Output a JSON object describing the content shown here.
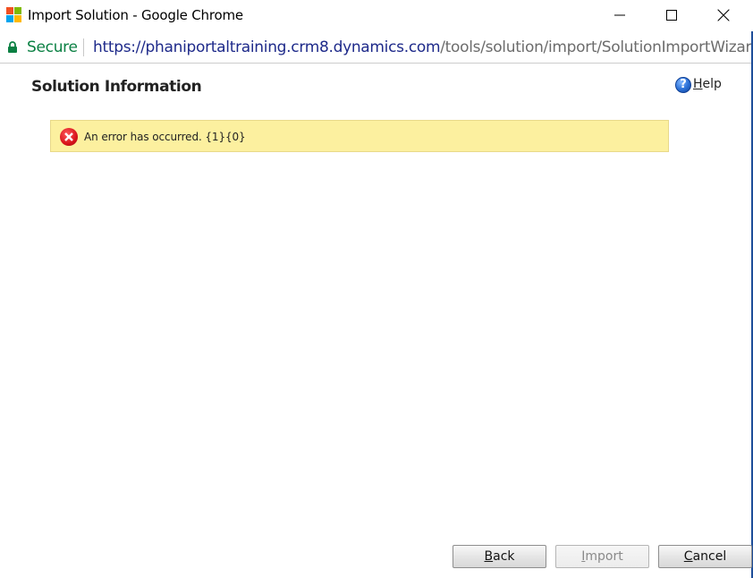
{
  "window": {
    "title": "Import Solution - Google Chrome",
    "controls": {
      "minimize": "minimize",
      "maximize": "maximize",
      "close": "close"
    }
  },
  "address_bar": {
    "security_label": "Secure",
    "url_host": "https://phaniportaltraining.crm8.dynamics.com",
    "url_path": "/tools/solution/import/SolutionImportWizard...."
  },
  "page": {
    "title": "Solution Information",
    "help": {
      "accel": "H",
      "rest": "elp",
      "icon": "question-mark"
    }
  },
  "error": {
    "message": "An error has occurred. {1}{0}",
    "icon": "error-x-icon",
    "background": "#fcf09f"
  },
  "footer": {
    "back": {
      "accel": "B",
      "rest": "ack",
      "enabled": true
    },
    "import": {
      "accel": "I",
      "rest": "mport",
      "enabled": false
    },
    "cancel": {
      "accel": "C",
      "rest": "ancel",
      "enabled": true
    }
  },
  "colors": {
    "secure_green": "#0b8043",
    "url_host": "#1e2a8a",
    "url_path": "#6c6c6c",
    "window_border": "#1f4e99",
    "error_red": "#d8141a"
  }
}
